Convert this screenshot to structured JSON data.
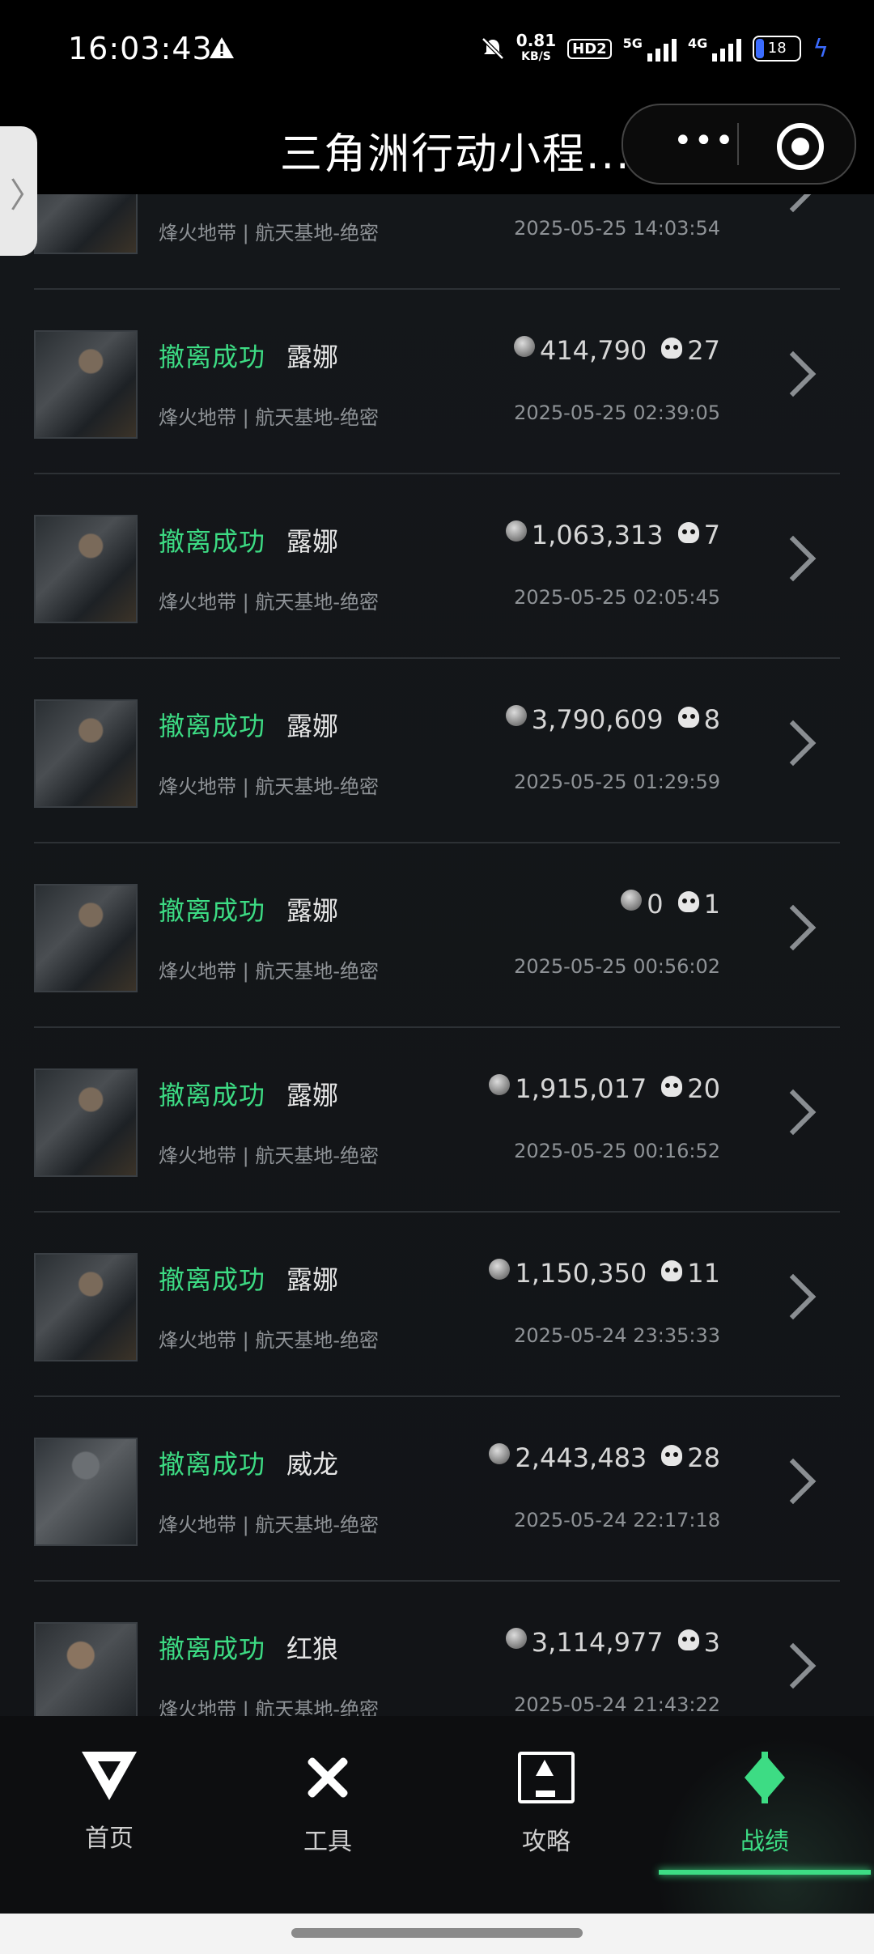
{
  "status_bar": {
    "time": "16:03:43",
    "speed_value": "0.81",
    "speed_unit": "KB/S",
    "hd_label": "HD2",
    "net1_label": "5G",
    "net2_label": "4G",
    "battery": "18"
  },
  "header": {
    "title": "三角洲行动小程..."
  },
  "records": [
    {
      "status": "",
      "operator": "",
      "map": "烽火地带 | 航天基地-绝密",
      "value": "",
      "kills": "",
      "datetime": "2025-05-25 14:03:54"
    },
    {
      "status": "撤离成功",
      "operator": "露娜",
      "map": "烽火地带 | 航天基地-绝密",
      "value": "414,790",
      "kills": "27",
      "datetime": "2025-05-25 02:39:05"
    },
    {
      "status": "撤离成功",
      "operator": "露娜",
      "map": "烽火地带 | 航天基地-绝密",
      "value": "1,063,313",
      "kills": "7",
      "datetime": "2025-05-25 02:05:45"
    },
    {
      "status": "撤离成功",
      "operator": "露娜",
      "map": "烽火地带 | 航天基地-绝密",
      "value": "3,790,609",
      "kills": "8",
      "datetime": "2025-05-25 01:29:59"
    },
    {
      "status": "撤离成功",
      "operator": "露娜",
      "map": "烽火地带 | 航天基地-绝密",
      "value": "0",
      "kills": "1",
      "datetime": "2025-05-25 00:56:02"
    },
    {
      "status": "撤离成功",
      "operator": "露娜",
      "map": "烽火地带 | 航天基地-绝密",
      "value": "1,915,017",
      "kills": "20",
      "datetime": "2025-05-25 00:16:52"
    },
    {
      "status": "撤离成功",
      "operator": "露娜",
      "map": "烽火地带 | 航天基地-绝密",
      "value": "1,150,350",
      "kills": "11",
      "datetime": "2025-05-24 23:35:33"
    },
    {
      "status": "撤离成功",
      "operator": "威龙",
      "map": "烽火地带 | 航天基地-绝密",
      "value": "2,443,483",
      "kills": "28",
      "datetime": "2025-05-24 22:17:18"
    },
    {
      "status": "撤离成功",
      "operator": "红狼",
      "map": "烽火地带 | 航天基地-绝密",
      "value": "3,114,977",
      "kills": "3",
      "datetime": "2025-05-24 21:43:22"
    }
  ],
  "tabs": [
    {
      "label": "首页",
      "icon": "home-icon"
    },
    {
      "label": "工具",
      "icon": "tools-icon"
    },
    {
      "label": "攻略",
      "icon": "guide-icon"
    },
    {
      "label": "战绩",
      "icon": "stats-icon",
      "active": true
    }
  ],
  "colors": {
    "accent": "#3ddc84",
    "background": "#111315"
  }
}
